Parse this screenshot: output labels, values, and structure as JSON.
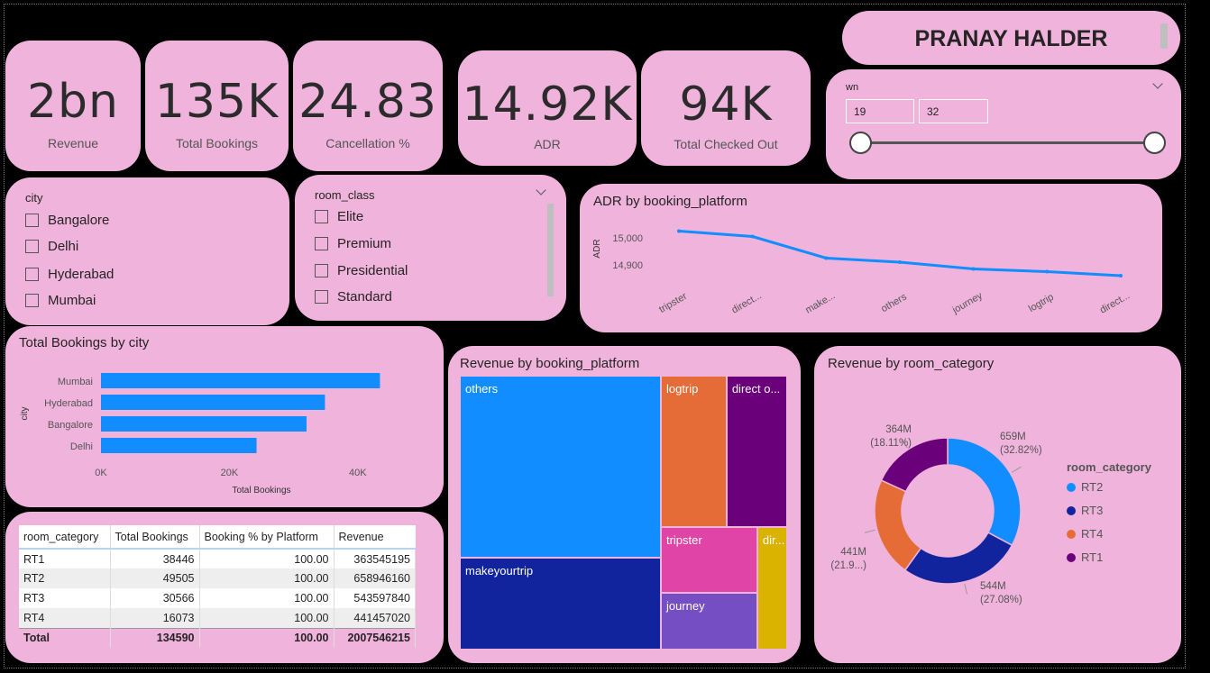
{
  "author": "PRANAY HALDER",
  "kpis": [
    {
      "value": "2bn",
      "label": "Revenue"
    },
    {
      "value": "135K",
      "label": "Total Bookings"
    },
    {
      "value": "24.83",
      "label": "Cancellation %"
    },
    {
      "value": "14.92K",
      "label": "ADR"
    },
    {
      "value": "94K",
      "label": "Total Checked Out"
    }
  ],
  "wn_slicer": {
    "title": "wn",
    "min": "19",
    "max": "32"
  },
  "city_slicer": {
    "title": "city",
    "items": [
      "Bangalore",
      "Delhi",
      "Hyderabad",
      "Mumbai"
    ]
  },
  "room_class_slicer": {
    "title": "room_class",
    "items": [
      "Elite",
      "Premium",
      "Presidential",
      "Standard"
    ]
  },
  "colors": {
    "accent": "#118dff",
    "card": "#f0b3dc",
    "navy": "#12239e",
    "orange": "#e66c37",
    "purple": "#6b007b",
    "pink": "#e044a7",
    "violet": "#744ec2",
    "gold": "#d9b300"
  },
  "chart_data": [
    {
      "id": "adr_platform",
      "type": "line",
      "title": "ADR by booking_platform",
      "xlabel": "",
      "ylabel": "ADR",
      "categories": [
        "tripster",
        "direct...",
        "make...",
        "others",
        "journey",
        "logtrip",
        "direct..."
      ],
      "values": [
        15025,
        15005,
        14925,
        14910,
        14885,
        14875,
        14860
      ],
      "yticks": [
        "15,000",
        "14,900"
      ],
      "ylim": [
        14850,
        15050
      ]
    },
    {
      "id": "bookings_city",
      "type": "bar",
      "title": "Total Bookings by city",
      "xlabel": "Total Bookings",
      "ylabel": "city",
      "categories": [
        "Mumbai",
        "Hyderabad",
        "Bangalore",
        "Delhi"
      ],
      "values": [
        43455,
        34888,
        32016,
        24231
      ],
      "xticks": [
        "0K",
        "20K",
        "40K"
      ],
      "xlim": [
        0,
        50000
      ]
    },
    {
      "id": "revenue_platform",
      "type": "treemap",
      "title": "Revenue by booking_platform",
      "categories": [
        "others",
        "makeyourtrip",
        "logtrip",
        "direct o...",
        "tripster",
        "journey",
        "dir..."
      ],
      "values": [
        800000000,
        402000000,
        217000000,
        200000000,
        139000000,
        119000000,
        80000000
      ]
    },
    {
      "id": "revenue_room",
      "type": "pie",
      "title": "Revenue by room_category",
      "legend_title": "room_category",
      "categories": [
        "RT2",
        "RT3",
        "RT4",
        "RT1"
      ],
      "values": [
        32.82,
        27.08,
        21.99,
        18.11
      ],
      "labels": [
        [
          "659M",
          "(32.82%)"
        ],
        [
          "544M",
          "(27.08%)"
        ],
        [
          "441M",
          "(21.9...)"
        ],
        [
          "364M",
          "(18.11%)"
        ]
      ]
    }
  ],
  "table": {
    "headers": [
      "room_category",
      "Total Bookings",
      "Booking % by Platform",
      "Revenue"
    ],
    "rows": [
      [
        "RT1",
        "38446",
        "100.00",
        "363545195"
      ],
      [
        "RT2",
        "49505",
        "100.00",
        "658946160"
      ],
      [
        "RT3",
        "30566",
        "100.00",
        "543597840"
      ],
      [
        "RT4",
        "16073",
        "100.00",
        "441457020"
      ]
    ],
    "total": [
      "Total",
      "134590",
      "100.00",
      "2007546215"
    ]
  }
}
